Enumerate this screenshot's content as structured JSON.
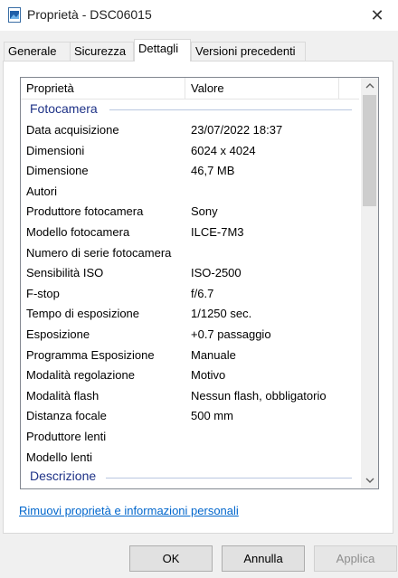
{
  "window": {
    "title": "Proprietà - DSC06015"
  },
  "tabs": [
    {
      "label": "Generale"
    },
    {
      "label": "Sicurezza"
    },
    {
      "label": "Dettagli"
    },
    {
      "label": "Versioni precedenti"
    }
  ],
  "active_tab": "Dettagli",
  "list": {
    "header_property": "Proprietà",
    "header_value": "Valore",
    "group_camera": "Fotocamera",
    "group_description": "Descrizione",
    "rows": [
      {
        "property": "Data acquisizione",
        "value": "23/07/2022 18:37"
      },
      {
        "property": "Dimensioni",
        "value": "6024 x 4024"
      },
      {
        "property": "Dimensione",
        "value": "46,7 MB"
      },
      {
        "property": "Autori",
        "value": ""
      },
      {
        "property": "Produttore fotocamera",
        "value": "Sony"
      },
      {
        "property": "Modello fotocamera",
        "value": "ILCE-7M3"
      },
      {
        "property": "Numero di serie fotocamera",
        "value": ""
      },
      {
        "property": "Sensibilità ISO",
        "value": "ISO-2500"
      },
      {
        "property": "F-stop",
        "value": "f/6.7"
      },
      {
        "property": "Tempo di esposizione",
        "value": "1/1250 sec."
      },
      {
        "property": "Esposizione",
        "value": "+0.7 passaggio"
      },
      {
        "property": "Programma Esposizione",
        "value": "Manuale"
      },
      {
        "property": "Modalità regolazione",
        "value": "Motivo"
      },
      {
        "property": "Modalità flash",
        "value": "Nessun flash, obbligatorio"
      },
      {
        "property": "Distanza focale",
        "value": "500 mm"
      },
      {
        "property": "Produttore lenti",
        "value": ""
      },
      {
        "property": "Modello lenti",
        "value": ""
      }
    ]
  },
  "remove_link": "Rimuovi proprietà e informazioni personali",
  "buttons": {
    "ok": "OK",
    "cancel": "Annulla",
    "apply": "Applica"
  },
  "icons": {
    "app": "image-file-icon",
    "close": "close-icon",
    "scroll_up": "chevron-up-icon",
    "scroll_down": "chevron-down-icon"
  }
}
